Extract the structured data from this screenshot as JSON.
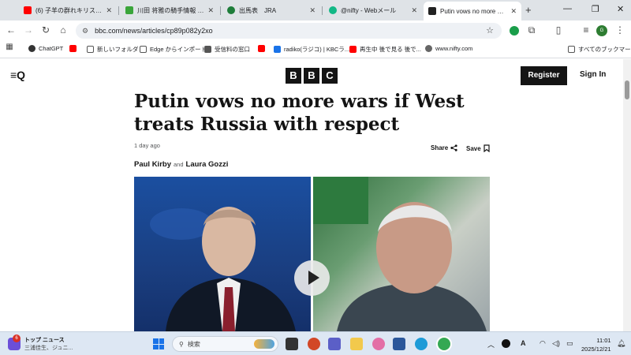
{
  "browser": {
    "tabs": [
      {
        "title": "(6) 子羊の群れキリスト教",
        "active": false
      },
      {
        "title": "川田 将雅の騎手情報 | 競",
        "active": false
      },
      {
        "title": "出馬表　JRA",
        "active": false
      },
      {
        "title": "@nifty - Webメール",
        "active": false
      },
      {
        "title": "Putin vows no more wars if",
        "active": true
      }
    ],
    "url": "bbc.com/news/articles/cp89p082y2xo",
    "profile_initial": "G",
    "bookmarks": [
      {
        "label": "ChatGPT"
      },
      {
        "label": "新しいフォルダ"
      },
      {
        "label": "Edge からインポート"
      },
      {
        "label": "受信料の窓口"
      },
      {
        "label": "radiko(ラジコ) | KBCラ..."
      },
      {
        "label": "再生中 後で見る 後で..."
      },
      {
        "label": "www.nifty.com"
      }
    ],
    "all_bookmarks_label": "すべてのブックマーク"
  },
  "bbc": {
    "logo_letters": [
      "B",
      "B",
      "C"
    ],
    "register_label": "Register",
    "signin_label": "Sign In"
  },
  "article": {
    "headline": "Putin vows no more wars if West treats Russia with respect",
    "timestamp": "1 day ago",
    "share_label": "Share",
    "save_label": "Save",
    "author1": "Paul Kirby",
    "and_label": "and",
    "author2": "Laura Gozzi"
  },
  "taskbar": {
    "news_badge": "6",
    "news_title": "トップ ニュース",
    "news_sub": "三浦佳生、ジュニ...",
    "search_placeholder": "検索",
    "time": "11:01",
    "date": "2025/12/21",
    "ime_indicator": "A"
  }
}
